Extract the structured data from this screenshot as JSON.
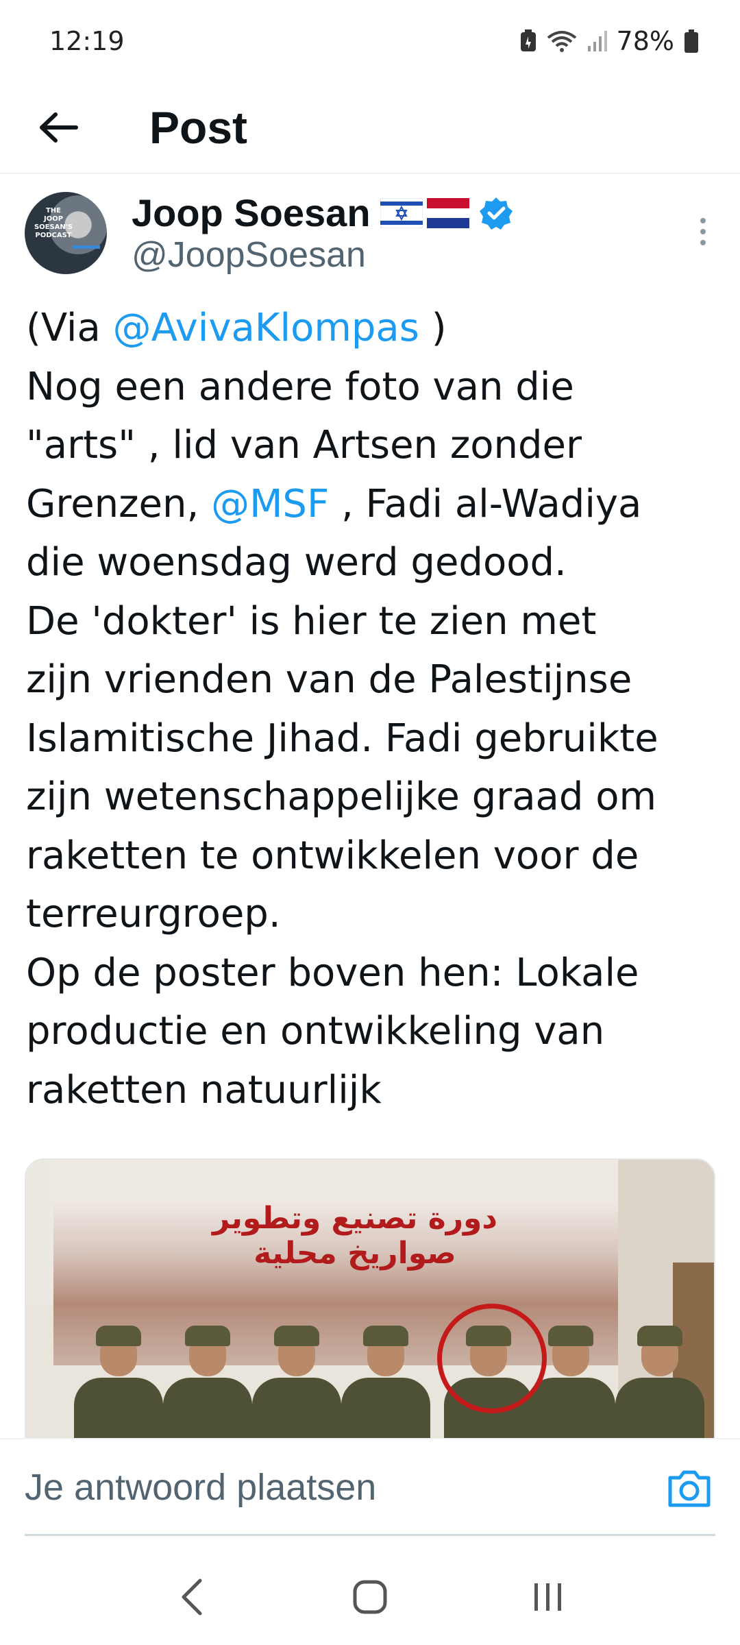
{
  "status_bar": {
    "time": "12:19",
    "battery": "78%",
    "icons": [
      "battery-saver-icon",
      "wifi-icon",
      "cellular-signal-icon",
      "battery-icon"
    ]
  },
  "app_bar": {
    "title": "Post",
    "back_icon": "arrow-left-icon"
  },
  "post": {
    "author": {
      "name": "Joop Soesan",
      "flags": [
        "israel-flag-icon",
        "netherlands-flag-icon"
      ],
      "verified": true,
      "handle": "@JoopSoesan",
      "avatar_text": "THE JOOP SOESAN'S PODCAST"
    },
    "body_lines": [
      {
        "before": "(Via ",
        "mention": "@AvivaKlompas",
        "after": " )"
      },
      {
        "before": "Nog een andere foto van die",
        "mention": "",
        "after": ""
      },
      {
        "before": "\"arts\" , lid van Artsen zonder",
        "mention": "",
        "after": ""
      },
      {
        "before": "Grenzen, ",
        "mention": "@MSF",
        "after": " , Fadi al-Wadiya"
      },
      {
        "before": "die woensdag werd gedood.",
        "mention": "",
        "after": ""
      },
      {
        "before": "De 'dokter' is hier te zien met",
        "mention": "",
        "after": ""
      },
      {
        "before": "zijn vrienden van de Palestijnse",
        "mention": "",
        "after": ""
      },
      {
        "before": "Islamitische Jihad. Fadi gebruikte",
        "mention": "",
        "after": ""
      },
      {
        "before": "zijn wetenschappelijke graad om",
        "mention": "",
        "after": ""
      },
      {
        "before": "raketten te ontwikkelen voor de",
        "mention": "",
        "after": ""
      },
      {
        "before": "terreurgroep.",
        "mention": "",
        "after": ""
      },
      {
        "before": "Op de poster boven hen: Lokale",
        "mention": "",
        "after": ""
      },
      {
        "before": "productie en ontwikkeling van",
        "mention": "",
        "after": ""
      },
      {
        "before": "raketten natuurlijk",
        "mention": "",
        "after": ""
      }
    ],
    "media": {
      "poster_text": "دورة تصنيع وتطوير صواريخ محلية"
    }
  },
  "reply": {
    "placeholder": "Je antwoord plaatsen",
    "camera_icon": "camera-icon"
  },
  "colors": {
    "accent": "#1d9bf0",
    "text": "#0f1419",
    "secondary": "#536471"
  }
}
